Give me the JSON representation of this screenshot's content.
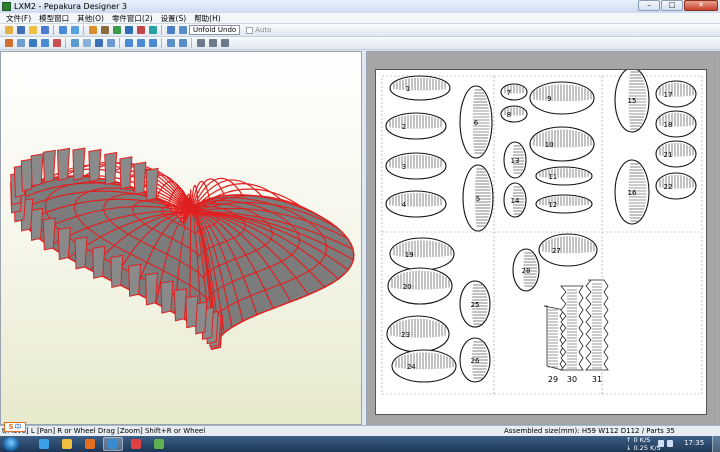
{
  "window": {
    "title": "LXM2 - Pepakura Designer 3",
    "min_symbol": "–",
    "max_symbol": "□",
    "close_symbol": "✕"
  },
  "menu": [
    "文件(F)",
    "模型窗口",
    "其他(O)",
    "零件窗口(2)",
    "设置(S)",
    "帮助(H)"
  ],
  "toolbar": {
    "unfold_undo_label": "Unfold Undo",
    "auto_label": "Auto"
  },
  "toolbar_icons": {
    "row1": [
      {
        "name": "open-file-icon",
        "color": "#e0b040"
      },
      {
        "name": "save-icon",
        "color": "#3f6fb5"
      },
      {
        "name": "paper-view-icon",
        "color": "#f0c040"
      },
      {
        "name": "model-3d-icon",
        "color": "#4c7bd1"
      },
      {
        "name": "sep"
      },
      {
        "name": "rotate-icon",
        "color": "#4a8ad4"
      },
      {
        "name": "flip-icon",
        "color": "#56a0e0"
      },
      {
        "name": "sep"
      },
      {
        "name": "pencil-icon",
        "color": "#d9902a"
      },
      {
        "name": "ruler-icon",
        "color": "#8c6b3e"
      },
      {
        "name": "join-icon",
        "color": "#3d9a4a"
      },
      {
        "name": "anchor-icon",
        "color": "#2f6fb0"
      },
      {
        "name": "cut-icon",
        "color": "#c04848"
      },
      {
        "name": "fold-icon",
        "color": "#2aa0a0"
      },
      {
        "name": "sep"
      },
      {
        "name": "layout-icon",
        "color": "#4a80c8"
      },
      {
        "name": "page-setup-icon",
        "color": "#5a8ec8"
      }
    ],
    "row2": [
      {
        "name": "select-icon",
        "color": "#d07030"
      },
      {
        "name": "wireframe-icon",
        "color": "#70a0d0"
      },
      {
        "name": "texture-icon",
        "color": "#3a7cc0"
      },
      {
        "name": "grid-icon",
        "color": "#4a8ad4"
      },
      {
        "name": "color-icon",
        "color": "#c85050"
      },
      {
        "name": "sep"
      },
      {
        "name": "edge-icon",
        "color": "#5a9ad0"
      },
      {
        "name": "face-icon",
        "color": "#88b0d8"
      },
      {
        "name": "number-icon",
        "color": "#3f6fb5"
      },
      {
        "name": "flap-icon",
        "color": "#6a9ad0"
      },
      {
        "name": "sep"
      },
      {
        "name": "zoom-in-icon",
        "color": "#4a8ad4"
      },
      {
        "name": "zoom-out-icon",
        "color": "#4a8ad4"
      },
      {
        "name": "zoom-fit-icon",
        "color": "#4a8ad4"
      },
      {
        "name": "sep"
      },
      {
        "name": "arrange-icon",
        "color": "#5a8ec8"
      },
      {
        "name": "align-icon",
        "color": "#5a8ec8"
      },
      {
        "name": "sep"
      },
      {
        "name": "magnify-icon",
        "color": "#6a7a8a"
      },
      {
        "name": "search-parts-icon",
        "color": "#6a7a8a"
      },
      {
        "name": "refresh-icon",
        "color": "#6a7a8a"
      }
    ]
  },
  "model_view": {
    "edge_color": "#e02020",
    "face_color": "#8a8a8a"
  },
  "parts": [
    {
      "id": "1",
      "shape": "h"
    },
    {
      "id": "2",
      "shape": "h"
    },
    {
      "id": "3",
      "shape": "h"
    },
    {
      "id": "4",
      "shape": "h"
    },
    {
      "id": "5",
      "shape": "v"
    },
    {
      "id": "6",
      "shape": "v"
    },
    {
      "id": "7",
      "shape": "h"
    },
    {
      "id": "8",
      "shape": "h"
    },
    {
      "id": "9",
      "shape": "h"
    },
    {
      "id": "10",
      "shape": "h"
    },
    {
      "id": "11",
      "shape": "h"
    },
    {
      "id": "12",
      "shape": "h"
    },
    {
      "id": "13",
      "shape": "v"
    },
    {
      "id": "14",
      "shape": "v"
    },
    {
      "id": "15",
      "shape": "v"
    },
    {
      "id": "16",
      "shape": "v"
    },
    {
      "id": "17",
      "shape": "h"
    },
    {
      "id": "18",
      "shape": "h"
    },
    {
      "id": "21",
      "shape": "h"
    },
    {
      "id": "22",
      "shape": "h"
    },
    {
      "id": "19",
      "shape": "h"
    },
    {
      "id": "20",
      "shape": "h"
    },
    {
      "id": "23",
      "shape": "h"
    },
    {
      "id": "24",
      "shape": "h"
    },
    {
      "id": "25",
      "shape": "v"
    },
    {
      "id": "26",
      "shape": "v"
    },
    {
      "id": "27",
      "shape": "h"
    },
    {
      "id": "28",
      "shape": "v"
    },
    {
      "id": "29",
      "shape": "strip"
    },
    {
      "id": "30",
      "shape": "strip"
    },
    {
      "id": "31",
      "shape": "strip"
    }
  ],
  "status": {
    "left": "t/Move] L [Pan] R or Wheel Drag [Zoom] Shift+R or Wheel",
    "right": "Assembled size(mm): H59 W112 D112 / Parts 35"
  },
  "taskbar": {
    "ime_s": "S",
    "ime_label": "中",
    "net_up": "0 K/S",
    "net_down": "0.25 K/S",
    "clock": "17:35",
    "tasks": [
      {
        "name": "taskbar-ie-icon",
        "color": "#3aa0e8"
      },
      {
        "name": "taskbar-explorer-icon",
        "color": "#f0c040"
      },
      {
        "name": "taskbar-mediaplayer-icon",
        "color": "#e07020"
      },
      {
        "name": "taskbar-pepakura-icon",
        "color": "#3a8ad0",
        "active": true
      },
      {
        "name": "taskbar-chrome-icon",
        "color": "#e04040"
      },
      {
        "name": "taskbar-app-icon",
        "color": "#60b050"
      }
    ]
  }
}
